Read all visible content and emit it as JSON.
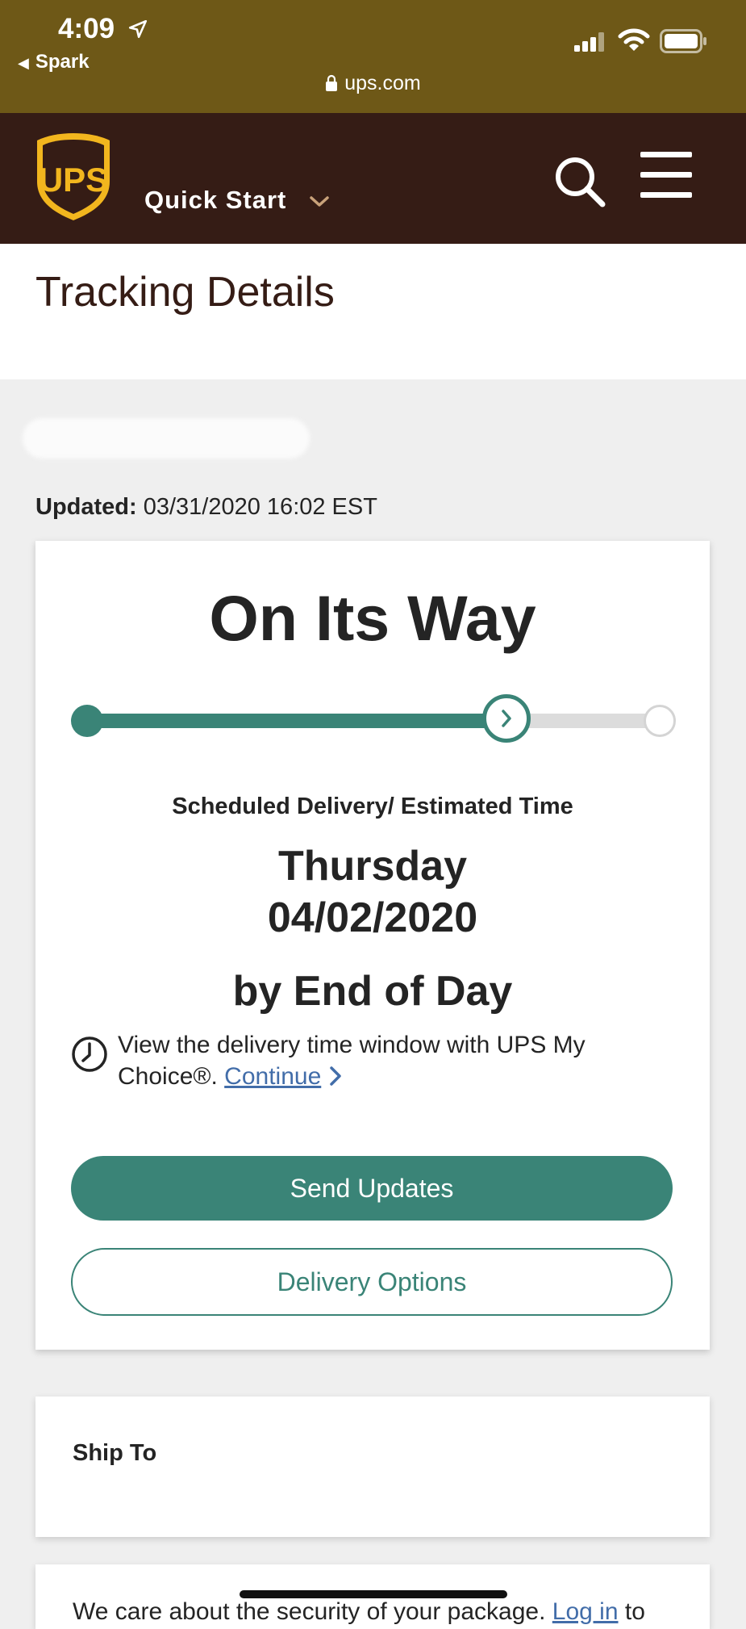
{
  "status_bar": {
    "time": "4:09",
    "back_app": "Spark",
    "url": "ups.com"
  },
  "header": {
    "logo_text": "UPS",
    "quick_start_label": "Quick Start"
  },
  "page": {
    "title": "Tracking Details"
  },
  "tracking": {
    "updated_label": "Updated:",
    "updated_value": "03/31/2020 16:02 EST",
    "status": "On Its Way",
    "progress_fraction": 0.73,
    "scheduled_label": "Scheduled Delivery/ Estimated Time",
    "delivery_day": "Thursday",
    "delivery_date": "04/02/2020",
    "delivery_time": "by End of Day",
    "mychoice_text": "View the delivery time window with UPS My Choice®.",
    "continue_label": "Continue",
    "send_updates_label": "Send Updates",
    "delivery_options_label": "Delivery Options"
  },
  "ship_to": {
    "label": "Ship To"
  },
  "security": {
    "text": "We care about the security of your package.",
    "login_label": "Log in",
    "trailing": "to"
  },
  "colors": {
    "status_bar_bg": "#6e5817",
    "header_bg": "#351c15",
    "accent": "#3a8477",
    "link": "#426da9",
    "logo_gold": "#f2b61e"
  },
  "icons": [
    "location-arrow-icon",
    "back-arrow-icon",
    "lock-icon",
    "signal-icon",
    "wifi-icon",
    "battery-icon",
    "ups-logo",
    "chevron-down-icon",
    "search-icon",
    "hamburger-menu-icon",
    "chevron-right-icon",
    "clock-icon"
  ]
}
